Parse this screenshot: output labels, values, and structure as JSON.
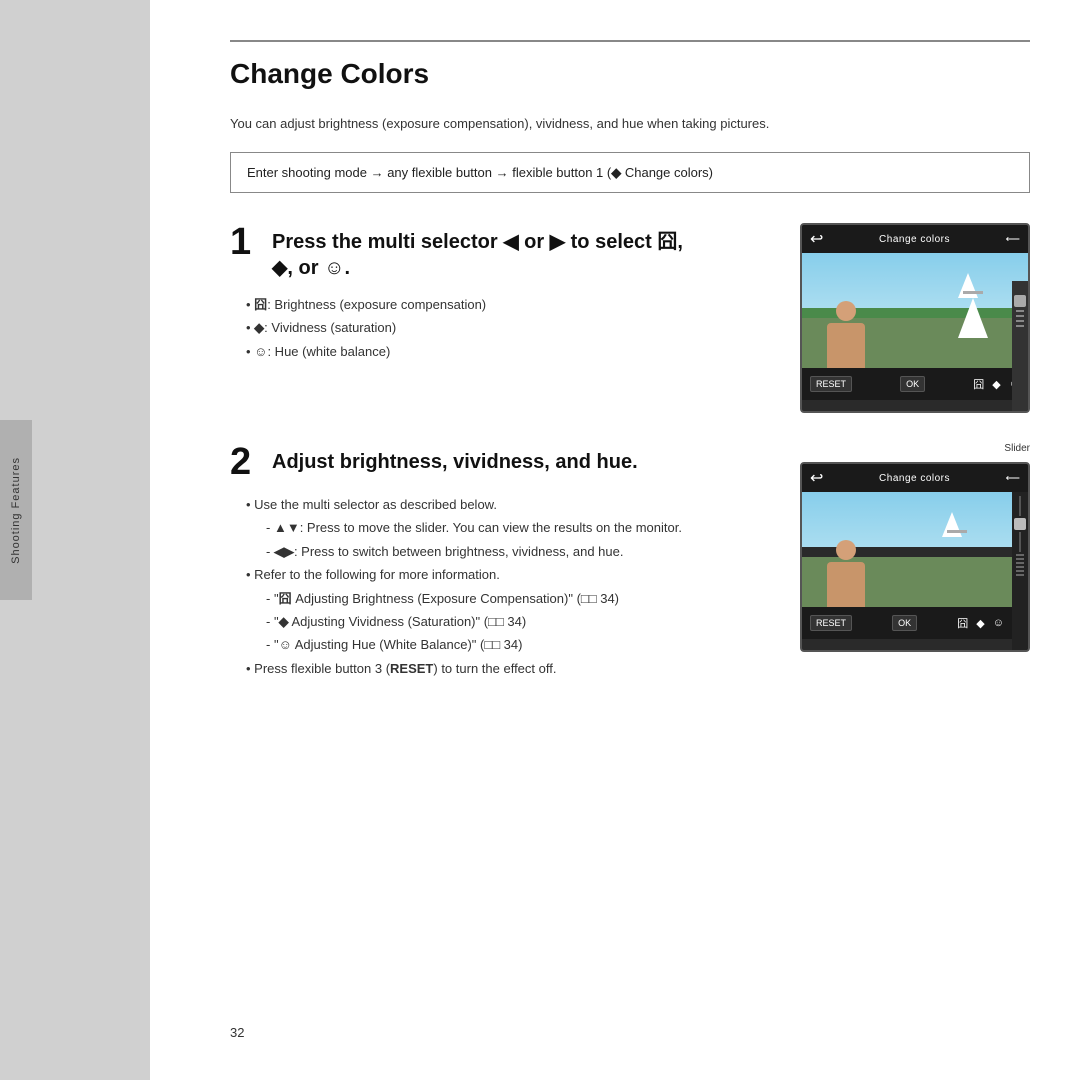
{
  "page": {
    "title": "Change Colors",
    "background_color": "#d0d0d0",
    "page_number": "32"
  },
  "sidebar": {
    "label": "Shooting Features"
  },
  "intro": {
    "text": "You can adjust brightness (exposure compensation), vividness, and hue when taking pictures."
  },
  "instruction_box": {
    "text": "Enter shooting mode → any flexible button → flexible button 1 (◆ Change colors)"
  },
  "step1": {
    "number": "1",
    "title": "Press the multi selector ◀ or ▶ to select 囧, ◆, or ☺.",
    "bullets": [
      "囧: Brightness (exposure compensation)",
      "◆: Vividness (saturation)",
      "☺: Hue (white balance)"
    ],
    "image": {
      "header_title": "Change colors",
      "back_icon": "↩",
      "reset_label": "RESET",
      "ok_label": "OK"
    }
  },
  "step2": {
    "number": "2",
    "title": "Adjust brightness, vividness, and hue.",
    "slider_label": "Slider",
    "bullets": [
      "Use the multi selector as described below.",
      "▲▼: Press to move the slider. You can view the results on the monitor.",
      "◀▶: Press to switch between brightness, vividness, and hue.",
      "Refer to the following for more information.",
      "\"囧 Adjusting Brightness (Exposure Compensation)\" (□□ 34)",
      "\"◆ Adjusting Vividness (Saturation)\" (□□ 34)",
      "\"☺ Adjusting Hue (White Balance)\" (□□ 34)",
      "Press flexible button 3 (RESET) to turn the effect off."
    ],
    "image": {
      "header_title": "Change colors",
      "back_icon": "↩",
      "reset_label": "RESET",
      "ok_label": "OK"
    }
  }
}
